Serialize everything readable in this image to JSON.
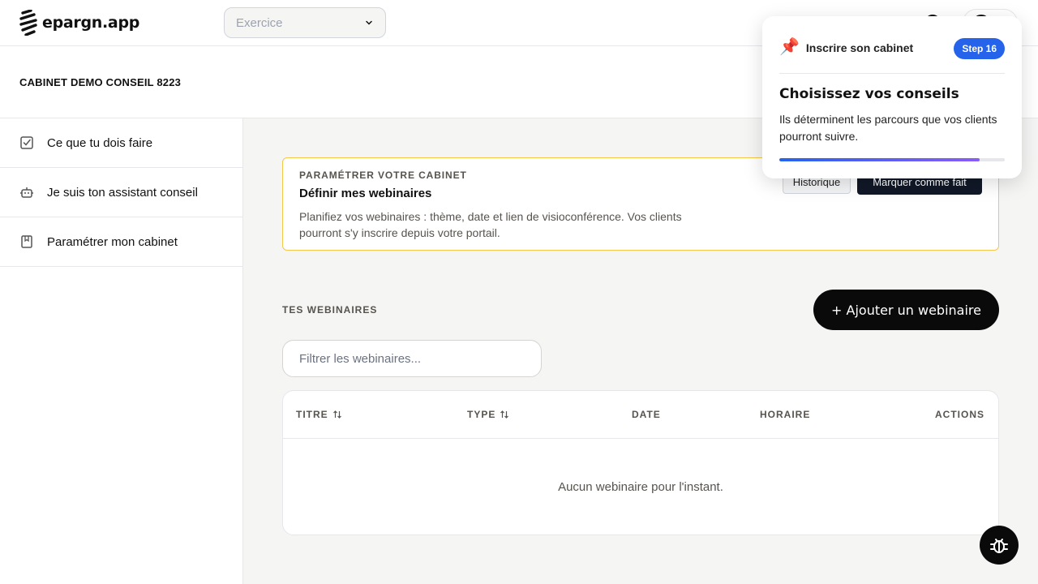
{
  "app": {
    "brand": "epargn.app"
  },
  "header": {
    "exercise": {
      "placeholder": "Exercice"
    }
  },
  "org": {
    "name": "CABINET DEMO CONSEIL 8223"
  },
  "sidebar": {
    "items": [
      {
        "label": "Ce que tu dois faire",
        "icon": "checklist-icon"
      },
      {
        "label": "Je suis ton assistant conseil",
        "icon": "robot-icon"
      },
      {
        "label": "Paramétrer mon cabinet",
        "icon": "bookmark-book-icon"
      }
    ]
  },
  "task": {
    "eyebrow": "PARAMÉTRER VOTRE CABINET",
    "title": "Définir mes webinaires",
    "description": "Planifiez vos webinaires : thème, date et lien de visioconférence. Vos clients pourront s'y inscrire depuis votre portail.",
    "history_label": "Historique",
    "done_label": "Marquer comme fait"
  },
  "webinars": {
    "section_title": "TES WEBINAIRES",
    "add_label": "+ Ajouter un webinaire",
    "filter_placeholder": "Filtrer les webinaires...",
    "columns": [
      "TITRE",
      "TYPE",
      "DATE",
      "HORAIRE",
      "ACTIONS"
    ],
    "empty": "Aucun webinaire pour l'instant."
  },
  "popover": {
    "label": "Inscrire son cabinet",
    "step": "Step 16",
    "title": "Choisissez vos conseils",
    "body": "Ils déterminent les parcours que vos clients pourront suivre.",
    "progress": 0.89
  },
  "colors": {
    "accent": "#2563eb",
    "task_border": "#f5c74a",
    "dark_button": "#0a0a0a"
  }
}
